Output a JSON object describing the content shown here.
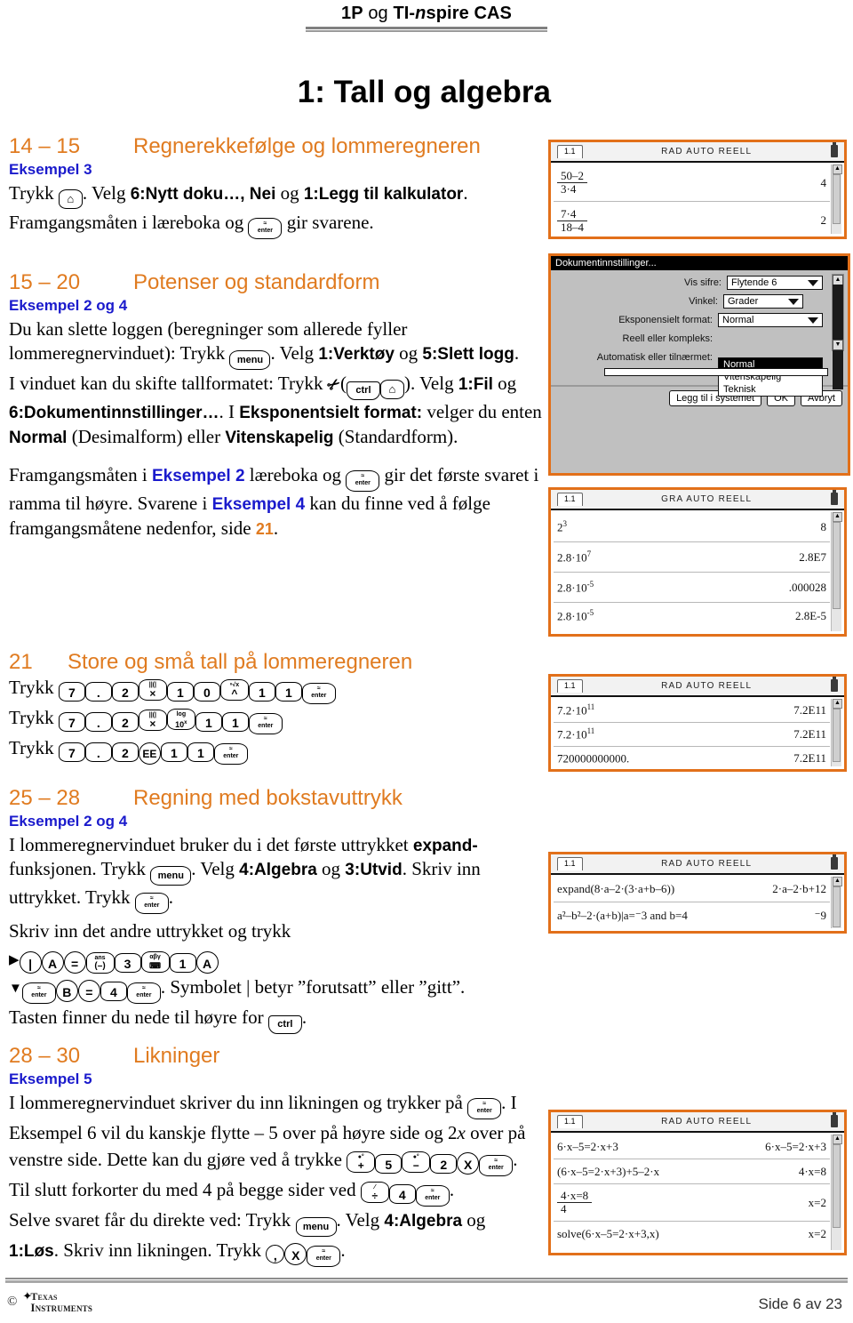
{
  "header": {
    "title_bold1": "1P",
    "title_reg": " og ",
    "title_bold2": "TI-",
    "title_ital": "n",
    "title_bold3": "spire CAS"
  },
  "chapter_title": "1: Tall og algebra",
  "colors": {
    "accent_orange": "#E07B20",
    "accent_blue": "#1A1ACC",
    "frame_orange": "#E2701A"
  },
  "sections": [
    {
      "pages": "14 – 15",
      "heading": "Regnerekkefølge og lommeregneren",
      "example": "Eksempel 3",
      "para1_a": "Trykk ",
      "para1_b": ". Velg ",
      "para1_bold1": "6:Nytt doku…, Nei",
      "para1_c": " og ",
      "para1_bold2": "1:Legg til kalkulator",
      "para1_d": ".",
      "para2_a": "Framgangsmåten i læreboka og ",
      "para2_b": " gir svarene."
    },
    {
      "pages": "15 – 20",
      "heading": "Potenser og standardform",
      "example": "Eksempel 2 og 4",
      "p1_a": "Du kan slette loggen (beregninger som allerede fyller lommeregnervinduet): Trykk ",
      "p1_b": ". Velg ",
      "p1_bold1": "1:Verktøy",
      "p1_c": " og ",
      "p1_bold2": "5:Slett logg",
      "p1_d": ".",
      "p2_a": "I vinduet kan du skifte tallformatet: Trykk ",
      "p2_b": ". Velg ",
      "p2_bold1": "1:Fil",
      "p2_c": " og ",
      "p2_bold2": "6:Dokumentinnstillinger…",
      "p2_d": ". I ",
      "p2_bold3": "Eksponentsielt format:",
      "p2_e": " velger du enten ",
      "p2_bold4": "Normal",
      "p2_f": " (Desimalform) eller ",
      "p2_bold5": "Vitenskapelig",
      "p2_g": " (Standardform).",
      "p3_a": "Framgangsmåten i ",
      "p3_blue1": "Eksempel 2",
      "p3_b": " læreboka og ",
      "p3_c": " gir det første svaret i ramma til høyre. Svarene i ",
      "p3_blue2": "Eksempel 4",
      "p3_d": " kan du finne ved å følge framgangsmåtene nedenfor, side ",
      "p3_orange": "21",
      "p3_e": "."
    },
    {
      "pages": "21",
      "heading": "Store og små tall på lommeregneren",
      "trykk_label": "Trykk",
      "key_rows": [
        [
          "7",
          ".",
          "2",
          "×",
          "1",
          "0",
          "^",
          "1",
          "1",
          "enter"
        ],
        [
          "7",
          ".",
          "2",
          "×",
          "10x",
          "1",
          "1",
          "enter"
        ],
        [
          "7",
          ".",
          "2",
          "EE",
          "1",
          "1",
          "enter"
        ]
      ]
    },
    {
      "pages": "25 – 28",
      "heading": "Regning med bokstavuttrykk",
      "example": "Eksempel 2 og 4",
      "p1_a": "I lommeregnervinduet bruker du i det første uttrykket ",
      "p1_bold1": "expand-",
      "p1_b": "funksjonen. Trykk ",
      "p1_c": ". Velg ",
      "p1_bold2": "4:Algebra",
      "p1_d": " og ",
      "p1_bold3": "3:Utvid",
      "p1_e": ". Skriv inn uttrykket. Trykk ",
      "p1_f": ".",
      "p2_a": "Skriv inn det andre uttrykket og trykk",
      "p2_keys_1": [
        "|",
        "A",
        "=",
        "(-)",
        "3",
        "αβγ",
        "1",
        "A"
      ],
      "p2_keys_2": [
        "enter",
        "B",
        "=",
        "4",
        "enter"
      ],
      "p2_b": ". Symbolet | betyr ”forutsatt” eller ”gitt”.",
      "p3_a": "Tasten finner du nede til høyre for ",
      "p3_b": "."
    },
    {
      "pages": "28 – 30",
      "heading": "Likninger",
      "example": "Eksempel 5",
      "p1_a": "I lommeregnervinduet skriver du inn likningen og trykker på ",
      "p1_b": ". I Eksempel 6 vil du kanskje flytte – 5 over på høyre side og 2",
      "p1_ital": "x",
      "p1_c": " over på venstre side. Dette kan du gjøre ved å trykke ",
      "p1_keys_1": [
        "+",
        "5",
        "−",
        "2",
        "X",
        "enter"
      ],
      "p1_d": ". Til slutt forkorter du med 4 på begge sider ved ",
      "p1_keys_2": [
        "÷",
        "4",
        "enter"
      ],
      "p1_e": ".",
      "p2_a": "Selve svaret får du direkte ved: Trykk ",
      "p2_b": ". Velg ",
      "p2_bold1": "4:Algebra",
      "p2_c": " og ",
      "p2_bold2": "1:Løs",
      "p2_d": ". Skriv inn likningen. Trykk ",
      "p2_keys": [
        ",",
        "X",
        "enter"
      ],
      "p2_e": "."
    }
  ],
  "screens": [
    {
      "id": "screen-regnerekkefolge",
      "tab": "1.1",
      "mode": "RAD AUTO REELL",
      "rows": [
        {
          "lhs_type": "fraction",
          "num": "50–2",
          "den": "3·4",
          "rhs": "4"
        },
        {
          "lhs_type": "fraction",
          "num": "7·4",
          "den": "18–4",
          "rhs": "2"
        }
      ]
    },
    {
      "id": "screen-potenser",
      "tab": "1.1",
      "mode": "GRA AUTO REELL",
      "rows": [
        {
          "lhs": "2",
          "sup": "3",
          "rhs": "8"
        },
        {
          "lhs": "2.8·10",
          "sup": "7",
          "rhs": "2.8E7"
        },
        {
          "lhs": "2.8·10",
          "sup": "-5",
          "rhs": ".000028"
        },
        {
          "lhs": "2.8·10",
          "sup": "-5",
          "rhs": "2.8E-5"
        }
      ]
    },
    {
      "id": "screen-store-sma-tall",
      "tab": "1.1",
      "mode": "RAD AUTO REELL",
      "rows": [
        {
          "lhs": "7.2·10",
          "sup": "11",
          "rhs": "7.2E11"
        },
        {
          "lhs": "7.2·10",
          "sup": "11",
          "rhs": "7.2E11"
        },
        {
          "lhs": "720000000000.",
          "sup": "",
          "rhs": "7.2E11"
        }
      ]
    },
    {
      "id": "screen-bokstavuttrykk",
      "tab": "1.1",
      "mode": "RAD AUTO REELL",
      "rows": [
        {
          "lhs": "expand(8·a–2·(3·a+b–6))",
          "rhs": "2·a–2·b+12"
        },
        {
          "lhs": "a²–b²–2·(a+b)|a=⁻3 and b=4",
          "rhs": "⁻9"
        }
      ]
    },
    {
      "id": "screen-likninger",
      "tab": "1.1",
      "mode": "RAD AUTO REELL",
      "rows": [
        {
          "lhs": "6·x–5=2·x+3",
          "rhs": "6·x–5=2·x+3"
        },
        {
          "lhs": "(6·x–5=2·x+3)+5–2·x",
          "rhs": "4·x=8"
        },
        {
          "lhs_type": "fraction",
          "num": "4·x=8",
          "den": "4",
          "rhs": "x=2"
        },
        {
          "lhs": "solve(6·x–5=2·x+3,x)",
          "rhs": "x=2"
        }
      ]
    }
  ],
  "dialog": {
    "id": "screen-dokumentinnstillinger",
    "title": "Dokumentinnstillinger...",
    "fields": [
      {
        "label": "Vis sifre:",
        "value": "Flytende 6"
      },
      {
        "label": "Vinkel:",
        "value": "Grader"
      },
      {
        "label": "Eksponensielt format:",
        "value": "Normal"
      },
      {
        "label": "Reell eller kompleks:",
        "value": ""
      },
      {
        "label": "Automatisk eller tilnærmet:",
        "value": ""
      }
    ],
    "dropdown_options": [
      "Normal",
      "Vitenskapelig",
      "Teknisk"
    ],
    "dropdown_selected": "Normal",
    "buttons": [
      "Legg til i systemet",
      "OK",
      "Avbryt"
    ]
  },
  "footer": {
    "logo_star": "✦",
    "copyright": "©",
    "logo_line1": "Texas",
    "logo_line2": "Instruments",
    "page": "Side 6 av 23"
  }
}
